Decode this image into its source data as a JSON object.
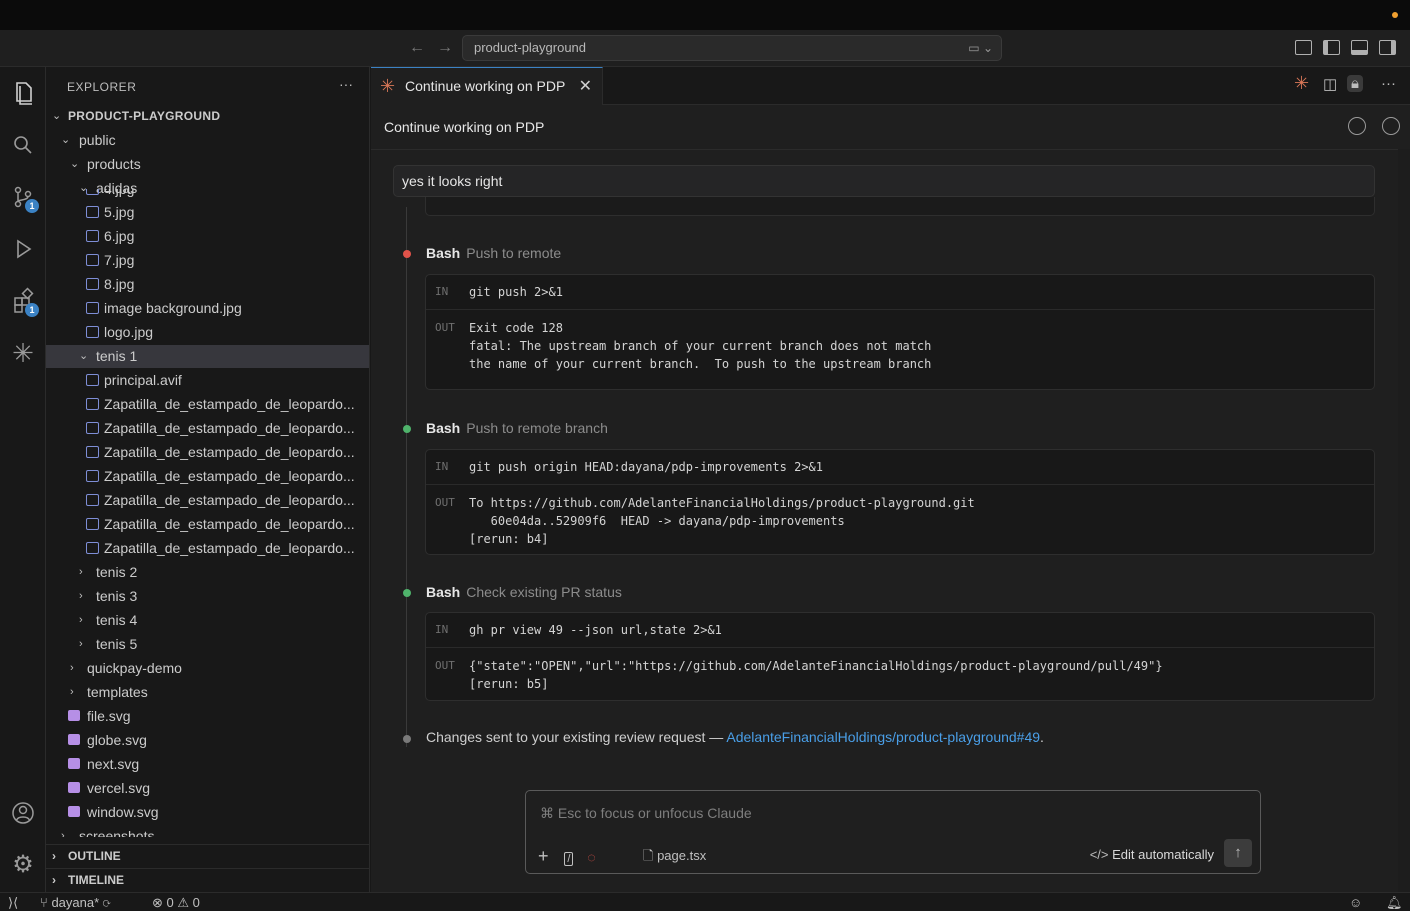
{
  "command_center": {
    "text": "product-playground"
  },
  "explorer": {
    "title": "EXPLORER",
    "root": "PRODUCT-PLAYGROUND",
    "items": [
      {
        "label": "public"
      },
      {
        "label": "products"
      },
      {
        "label": "adidas"
      },
      {
        "label": "4.jpg"
      },
      {
        "label": "5.jpg"
      },
      {
        "label": "6.jpg"
      },
      {
        "label": "7.jpg"
      },
      {
        "label": "8.jpg"
      },
      {
        "label": "image background.jpg"
      },
      {
        "label": "logo.jpg"
      },
      {
        "label": "tenis 1"
      },
      {
        "label": "principal.avif"
      },
      {
        "label": "Zapatilla_de_estampado_de_leopardo..."
      },
      {
        "label": "Zapatilla_de_estampado_de_leopardo..."
      },
      {
        "label": "Zapatilla_de_estampado_de_leopardo..."
      },
      {
        "label": "Zapatilla_de_estampado_de_leopardo..."
      },
      {
        "label": "Zapatilla_de_estampado_de_leopardo..."
      },
      {
        "label": "Zapatilla_de_estampado_de_leopardo..."
      },
      {
        "label": "Zapatilla_de_estampado_de_leopardo..."
      },
      {
        "label": "tenis 2"
      },
      {
        "label": "tenis 3"
      },
      {
        "label": "tenis 4"
      },
      {
        "label": "tenis 5"
      },
      {
        "label": "quickpay-demo"
      },
      {
        "label": "templates"
      },
      {
        "label": "file.svg"
      },
      {
        "label": "globe.svg"
      },
      {
        "label": "next.svg"
      },
      {
        "label": "vercel.svg"
      },
      {
        "label": "window.svg"
      },
      {
        "label": "screenshots"
      }
    ],
    "outline": "OUTLINE",
    "timeline": "TIMELINE"
  },
  "activity_bar": {
    "scm_badge": "1",
    "extensions_badge": "1"
  },
  "tab": {
    "title": "Continue working on PDP"
  },
  "conversation": {
    "title": "Continue working on PDP",
    "user_message": "yes it looks right",
    "steps": [
      {
        "tool": "Bash",
        "desc": "Push to remote",
        "status_color": "#e0534a",
        "in_label": "IN",
        "in": "git push 2>&1",
        "out_label": "OUT",
        "out": "Exit code 128\nfatal: The upstream branch of your current branch does not match\nthe name of your current branch.  To push to the upstream branch"
      },
      {
        "tool": "Bash",
        "desc": "Push to remote branch",
        "status_color": "#4fb36b",
        "in_label": "IN",
        "in": "git push origin HEAD:dayana/pdp-improvements 2>&1",
        "out_label": "OUT",
        "out": "To https://github.com/AdelanteFinancialHoldings/product-playground.git\n   60e04da..52909f6  HEAD -> dayana/pdp-improvements\n[rerun: b4]"
      },
      {
        "tool": "Bash",
        "desc": "Check existing PR status",
        "status_color": "#4fb36b",
        "in_label": "IN",
        "in": "gh pr view 49 --json url,state 2>&1",
        "out_label": "OUT",
        "out": "{\"state\":\"OPEN\",\"url\":\"https://github.com/AdelanteFinancialHoldings/product-playground/pull/49\"}\n[rerun: b5]"
      }
    ],
    "final_text": "Changes sent to your existing review request — ",
    "final_link": "AdelanteFinancialHoldings/product-playground#49",
    "final_end": "."
  },
  "composer": {
    "placeholder": "⌘ Esc to focus or unfocus Claude",
    "file": "page.tsx",
    "mode": "Edit automatically"
  },
  "status": {
    "branch": "dayana*",
    "errors": "0",
    "warnings": "0"
  },
  "colors": {
    "accent": "#3b82c4",
    "claude": "#d97757",
    "link": "#4a9fe8"
  }
}
